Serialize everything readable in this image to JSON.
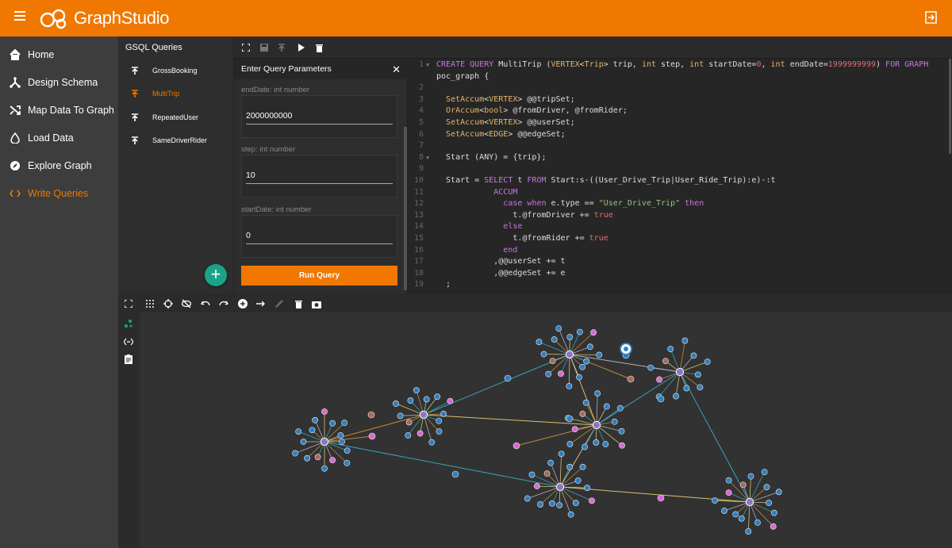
{
  "header": {
    "brand": "GraphStudio"
  },
  "sidebar": {
    "items": [
      {
        "label": "Home"
      },
      {
        "label": "Design Schema"
      },
      {
        "label": "Map Data To Graph"
      },
      {
        "label": "Load Data"
      },
      {
        "label": "Explore Graph"
      },
      {
        "label": "Write Queries"
      }
    ],
    "active": "Write Queries"
  },
  "queries": {
    "title": "GSQL Queries",
    "items": [
      {
        "label": "GrossBooking"
      },
      {
        "label": "MultiTrip"
      },
      {
        "label": "RepeatedUser"
      },
      {
        "label": "SameDriverRider"
      }
    ],
    "active": "MultiTrip"
  },
  "params": {
    "title": "Enter Query Parameters",
    "fields": [
      {
        "label": "endDate: int number",
        "value": "2000000000"
      },
      {
        "label": "step: int number",
        "value": "10"
      },
      {
        "label": "startDate: int number",
        "value": "0"
      }
    ],
    "run_label": "Run Query"
  },
  "editor": {
    "line_numbers": [
      "1",
      "",
      "2",
      "3",
      "4",
      "5",
      "6",
      "7",
      "8",
      "9",
      "10",
      "11",
      "12",
      "13",
      "14",
      "15",
      "16",
      "17",
      "18",
      "19"
    ],
    "lines": [
      "CREATE QUERY MultiTrip (VERTEX<Trip> trip, int step, int startDate=0, int endDate=1999999999) FOR GRAPH",
      "poc_graph {",
      "",
      "  SetAccum<VERTEX> @@tripSet;",
      "  OrAccum<bool> @fromDriver, @fromRider;",
      "  SetAccum<VERTEX> @@userSet;",
      "  SetAccum<EDGE> @@edgeSet;",
      "",
      "  Start (ANY) = {trip};",
      "",
      "  Start = SELECT t FROM Start:s-((User_Drive_Trip|User_Ride_Trip):e)-:t",
      "            ACCUM",
      "              case when e.type == \"User_Drive_Trip\" then",
      "                t.@fromDriver += true",
      "              else",
      "                t.@fromRider += true",
      "              end",
      "            ,@@userSet += t",
      "            ,@@edgeSet += e",
      "  ;"
    ]
  },
  "colors": {
    "accent": "#f07800",
    "fab": "#1aa388",
    "node_blue": "#2f7fc1",
    "node_pink": "#d86ad2",
    "node_brown": "#a86a5c",
    "node_purple": "#8b76c8"
  }
}
